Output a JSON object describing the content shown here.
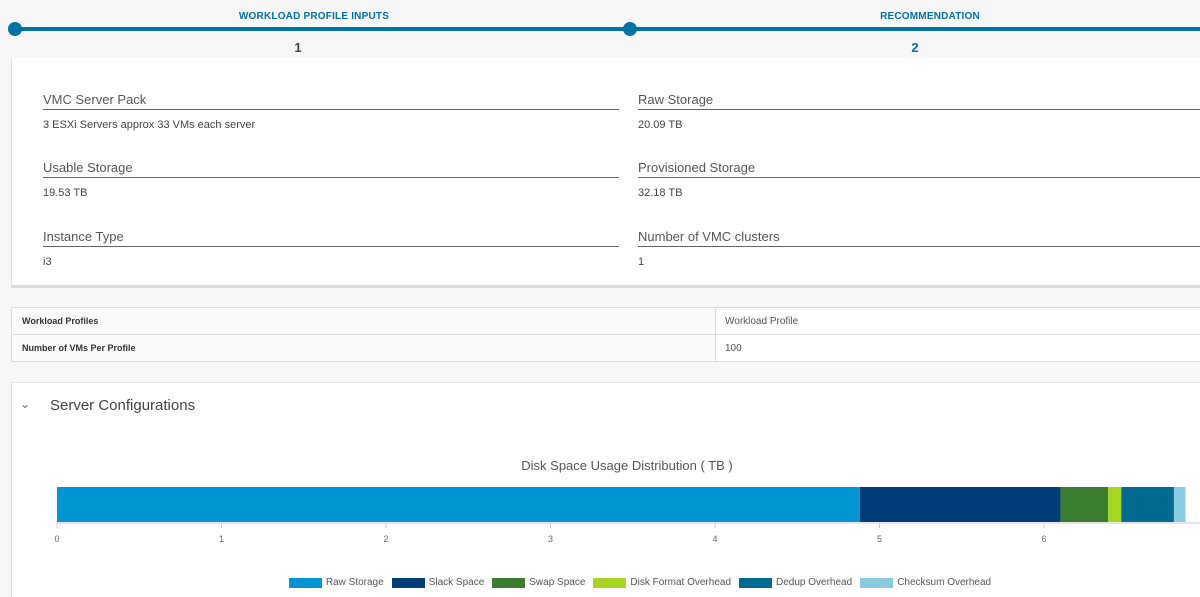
{
  "stepper": {
    "steps": [
      {
        "title": "WORKLOAD PROFILE INPUTS",
        "number": "1"
      },
      {
        "title": "RECOMMENDATION",
        "number": "2"
      }
    ],
    "accent": "#0072a3"
  },
  "summary": {
    "server_pack": {
      "label": "VMC Server Pack",
      "value": "3 ESXi Servers approx 33 VMs each server"
    },
    "raw_storage": {
      "label": "Raw Storage",
      "value": "20.09 TB"
    },
    "usable_storage": {
      "label": "Usable Storage",
      "value": "19.53 TB"
    },
    "provisioned_storage": {
      "label": "Provisioned Storage",
      "value": "32.18 TB"
    },
    "instance_type": {
      "label": "Instance Type",
      "value": "i3"
    },
    "vmc_clusters": {
      "label": "Number of VMC clusters",
      "value": "1"
    }
  },
  "profiles": {
    "rows": [
      {
        "key": "Workload Profiles",
        "value": "Workload Profile"
      },
      {
        "key": "Number of VMs Per Profile",
        "value": "100"
      }
    ]
  },
  "server_configurations": {
    "title": "Server Configurations",
    "chevron_icon": "chevron-down-icon"
  },
  "chart_data": {
    "type": "bar",
    "orientation": "horizontal-stacked",
    "title": "Disk Space Usage Distribution ( TB )",
    "categories": [
      ""
    ],
    "series": [
      {
        "name": "Raw Storage",
        "values": [
          4.88
        ],
        "color": "#0095d3"
      },
      {
        "name": "Slack Space",
        "values": [
          1.22
        ],
        "color": "#003d79"
      },
      {
        "name": "Swap Space",
        "values": [
          0.29
        ],
        "color": "#3b7d2e"
      },
      {
        "name": "Disk Format Overhead",
        "values": [
          0.08
        ],
        "color": "#a6d61f"
      },
      {
        "name": "Dedup Overhead",
        "values": [
          0.32
        ],
        "color": "#006a91"
      },
      {
        "name": "Checksum Overhead",
        "values": [
          0.07
        ],
        "color": "#89cbdf"
      }
    ],
    "xlim": [
      0,
      7
    ],
    "xticks": [
      "0",
      "1",
      "2",
      "3",
      "4",
      "5",
      "6"
    ],
    "legend_position": "bottom",
    "grid": false
  }
}
